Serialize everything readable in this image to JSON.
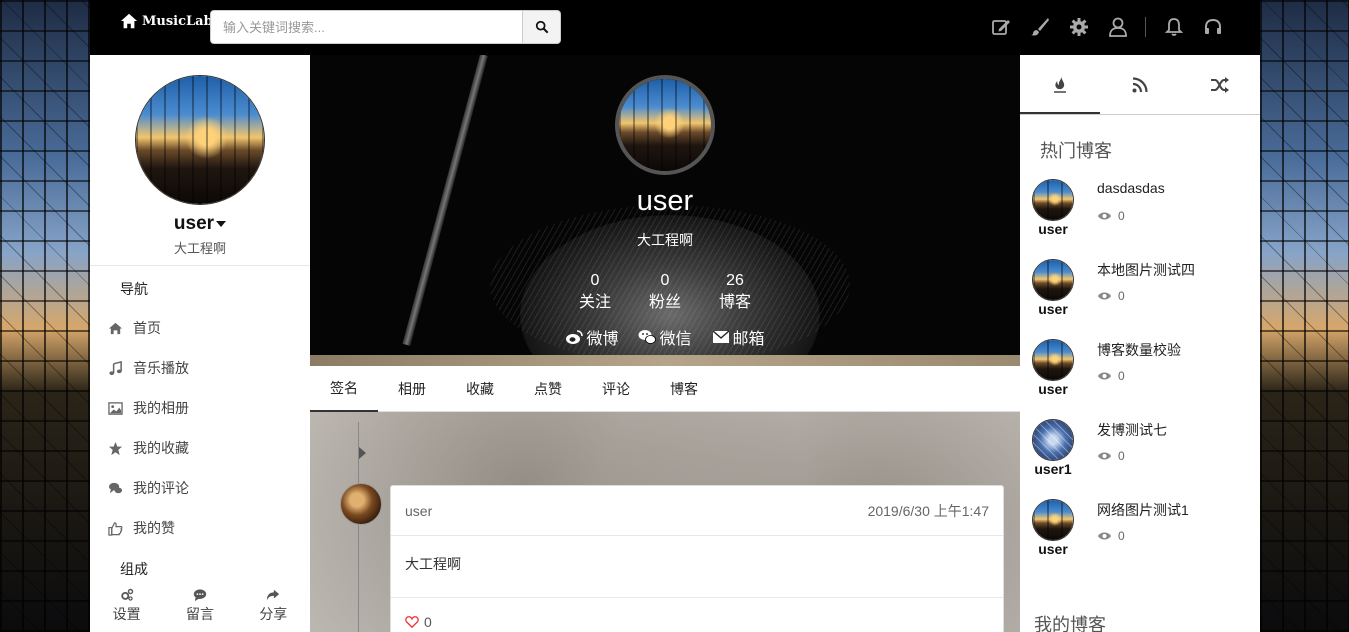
{
  "header": {
    "logo": "MusicLab",
    "search_placeholder": "输入关键词搜索..."
  },
  "top_icons": [
    "edit-icon",
    "brush-icon",
    "gear-icon",
    "user-icon",
    "bell-icon",
    "headphones-icon"
  ],
  "leftbar": {
    "name": "user",
    "subtitle": "大工程啊",
    "nav_section": "导航",
    "nav_items": [
      {
        "label": "首页",
        "icon": "home-icon"
      },
      {
        "label": "音乐播放",
        "icon": "music-icon"
      },
      {
        "label": "我的相册",
        "icon": "image-icon"
      },
      {
        "label": "我的收藏",
        "icon": "star-icon"
      },
      {
        "label": "我的评论",
        "icon": "comments-icon"
      },
      {
        "label": "我的赞",
        "icon": "thumbs-up-icon"
      }
    ],
    "group_section": "组成",
    "bottom": [
      {
        "label": "设置",
        "icon": "cogs-icon"
      },
      {
        "label": "留言",
        "icon": "comment-icon"
      },
      {
        "label": "分享",
        "icon": "share-icon"
      }
    ]
  },
  "profile": {
    "name": "user",
    "subtitle": "大工程啊",
    "stats": [
      {
        "value": "0",
        "label": "关注"
      },
      {
        "value": "0",
        "label": "粉丝"
      },
      {
        "value": "26",
        "label": "博客"
      }
    ],
    "socials": [
      {
        "label": "微博",
        "icon": "weibo-icon"
      },
      {
        "label": "微信",
        "icon": "wechat-icon"
      },
      {
        "label": "邮箱",
        "icon": "envelope-icon"
      }
    ],
    "tabs": [
      "签名",
      "相册",
      "收藏",
      "点赞",
      "评论",
      "博客"
    ],
    "active_tab": "签名"
  },
  "post": {
    "user": "user",
    "time": "2019/6/30 上午1:47",
    "content": "大工程啊",
    "likes": "0"
  },
  "rightbar": {
    "tabs": [
      "fire-icon",
      "rss-icon",
      "random-icon"
    ],
    "hot_title": "热门博客",
    "hot_items": [
      {
        "user": "user",
        "title": "dasdasdas",
        "views": "0"
      },
      {
        "user": "user",
        "title": "本地图片测试四",
        "views": "0"
      },
      {
        "user": "user",
        "title": "博客数量校验",
        "views": "0"
      },
      {
        "user": "user1",
        "title": "发博测试七",
        "views": "0"
      },
      {
        "user": "user",
        "title": "网络图片测试1",
        "views": "0"
      }
    ],
    "my_title": "我的博客"
  }
}
